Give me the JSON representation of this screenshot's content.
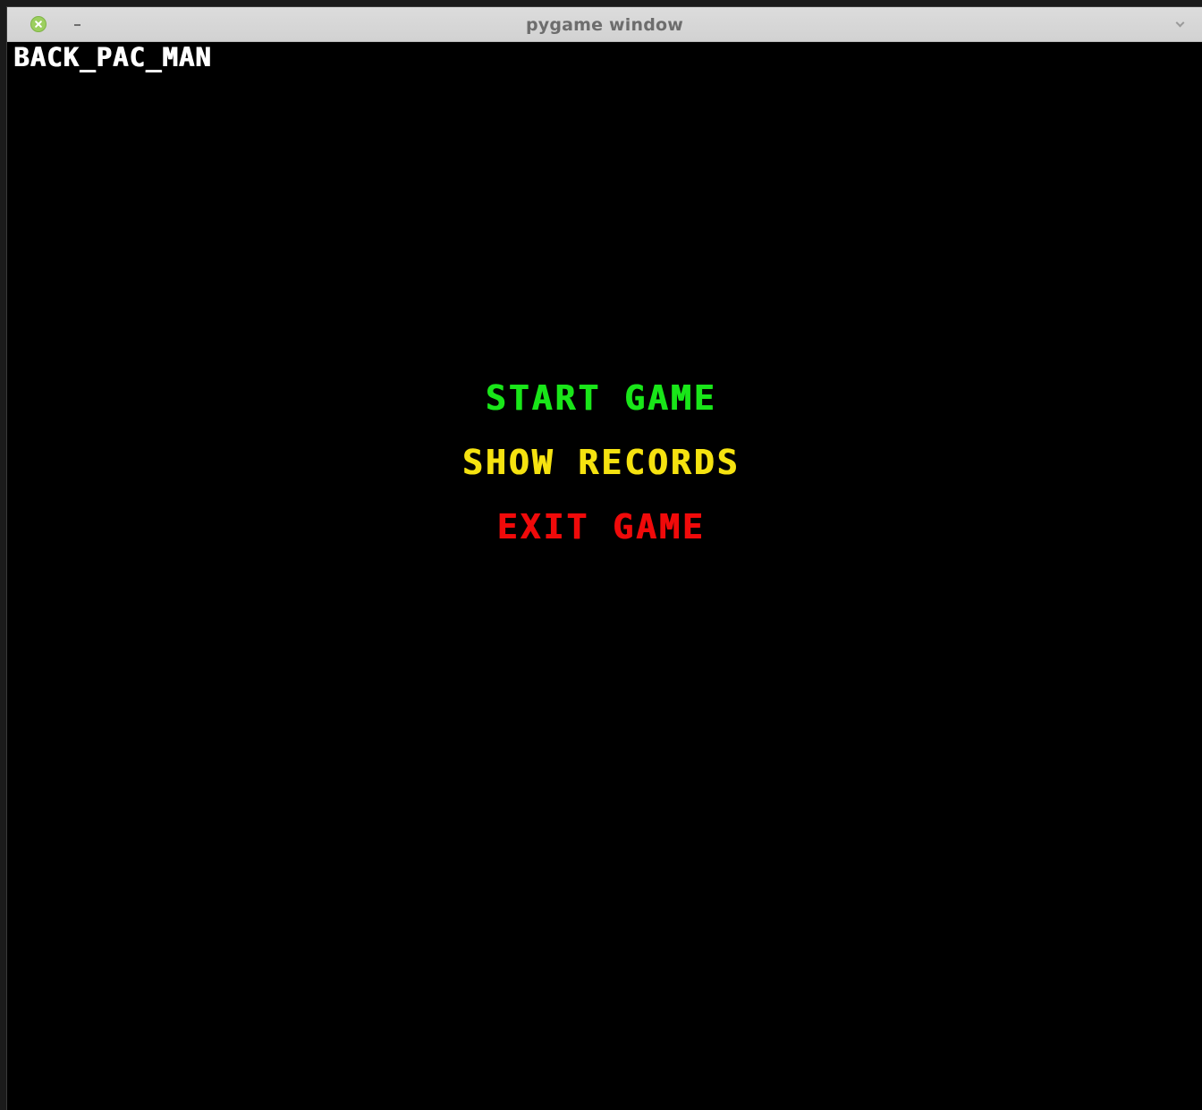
{
  "window": {
    "title": "pygame window"
  },
  "game": {
    "title": "BACK_PAC_MAN",
    "title_color": "#ffffff",
    "background_color": "#000000"
  },
  "menu": {
    "items": [
      {
        "label": "START GAME",
        "color": "#19e619"
      },
      {
        "label": "SHOW RECORDS",
        "color": "#f5e210"
      },
      {
        "label": "EXIT GAME",
        "color": "#f00a0a"
      }
    ]
  },
  "icons": {
    "close": "close-icon",
    "minimize": "minimize-icon",
    "menu": "chevron-down-icon"
  }
}
